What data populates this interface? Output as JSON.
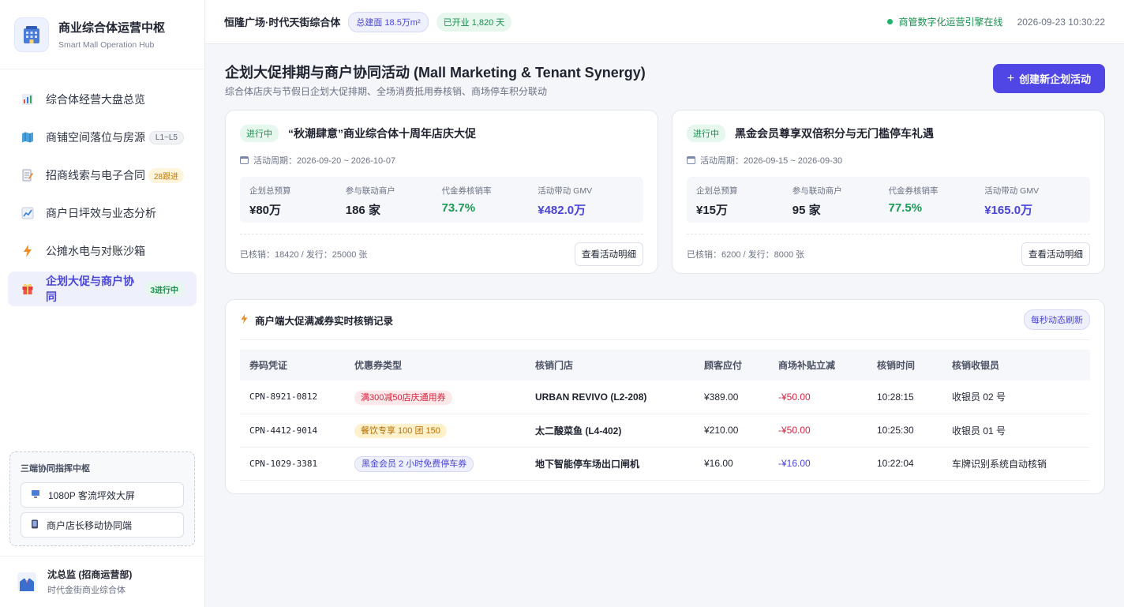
{
  "sidebar": {
    "brand_title": "商业综合体运营中枢",
    "brand_subtitle": "Smart Mall Operation Hub",
    "items": [
      {
        "label": "综合体经营大盘总览",
        "badge": ""
      },
      {
        "label": "商铺空间落位与房源",
        "badge": "L1~L5"
      },
      {
        "label": "招商线索与电子合同",
        "badge": "28跟进"
      },
      {
        "label": "商户日坪效与业态分析",
        "badge": ""
      },
      {
        "label": "公摊水电与对账沙箱",
        "badge": ""
      },
      {
        "label": "企划大促与商户协同",
        "badge": "3进行中"
      }
    ],
    "sync_title": "三端协同指挥中枢",
    "sync_buttons": [
      "1080P 客流坪效大屏",
      "商户店长移动协同端"
    ],
    "user_name": "沈总监 (招商运营部)",
    "user_org": "时代金街商业综合体"
  },
  "topbar": {
    "mall_name": "恒隆广场·时代天街综合体",
    "area_pill": "总建面 18.5万m²",
    "open_pill": "已开业 1,820 天",
    "online_text": "商管数字化运营引擎在线",
    "datetime": "2026-09-23 10:30:22"
  },
  "header": {
    "title": "企划大促排期与商户协同活动 (Mall Marketing & Tenant Synergy)",
    "subtitle": "综合体店庆与节假日企划大促排期、全场消费抵用券核销、商场停车积分联动",
    "create_button": "创建新企划活动"
  },
  "campaigns": [
    {
      "status": "进行中",
      "title": "“秋潮肆意”商业综合体十周年店庆大促",
      "period": "活动周期：2026-09-20 ~ 2026-10-07",
      "stats": [
        {
          "label": "企划总预算",
          "value": "¥80万"
        },
        {
          "label": "参与联动商户",
          "value": "186 家"
        },
        {
          "label": "代金券核销率",
          "value": "73.7%"
        },
        {
          "label": "活动带动 GMV",
          "value": "¥482.0万"
        }
      ],
      "issued": "已核销：18420 / 发行：25000 张",
      "detail_button": "查看活动明细"
    },
    {
      "status": "进行中",
      "title": "黑金会员尊享双倍积分与无门槛停车礼遇",
      "period": "活动周期：2026-09-15 ~ 2026-09-30",
      "stats": [
        {
          "label": "企划总预算",
          "value": "¥15万"
        },
        {
          "label": "参与联动商户",
          "value": "95 家"
        },
        {
          "label": "代金券核销率",
          "value": "77.5%"
        },
        {
          "label": "活动带动 GMV",
          "value": "¥165.0万"
        }
      ],
      "issued": "已核销：6200 / 发行：8000 张",
      "detail_button": "查看活动明细"
    }
  ],
  "records": {
    "title": "商户端大促满减券实时核销记录",
    "refresh_badge": "每秒动态刷新",
    "columns": [
      "券码凭证",
      "优惠券类型",
      "核销门店",
      "顾客应付",
      "商场补贴立减",
      "核销时间",
      "核销收银员"
    ],
    "rows": [
      {
        "code": "CPN-8921-0812",
        "type": "满300减50店庆通用券",
        "store": "URBAN REVIVO (L2-208)",
        "pay": "¥389.00",
        "subsidy": "-¥50.00",
        "time": "10:28:15",
        "cashier": "收银员 02 号"
      },
      {
        "code": "CPN-4412-9014",
        "type": "餐饮专享 100 团 150",
        "store": "太二酸菜鱼 (L4-402)",
        "pay": "¥210.00",
        "subsidy": "-¥50.00",
        "time": "10:25:30",
        "cashier": "收银员 01 号"
      },
      {
        "code": "CPN-1029-3381",
        "type": "黑金会员 2 小时免费停车券",
        "store": "地下智能停车场出口闸机",
        "pay": "¥16.00",
        "subsidy": "-¥16.00",
        "time": "10:22:04",
        "cashier": "车牌识别系统自动核销"
      }
    ]
  },
  "icons": {
    "nav": [
      "bar-chart-icon",
      "map-icon",
      "contract-icon",
      "trend-icon",
      "lightning-icon",
      "gift-icon"
    ],
    "sync": [
      "monitor-icon",
      "mobile-icon"
    ]
  },
  "colors": {
    "accent": "#4f46e5",
    "success": "#1a9a55",
    "danger": "#d6243f",
    "warning": "#c77a00"
  }
}
